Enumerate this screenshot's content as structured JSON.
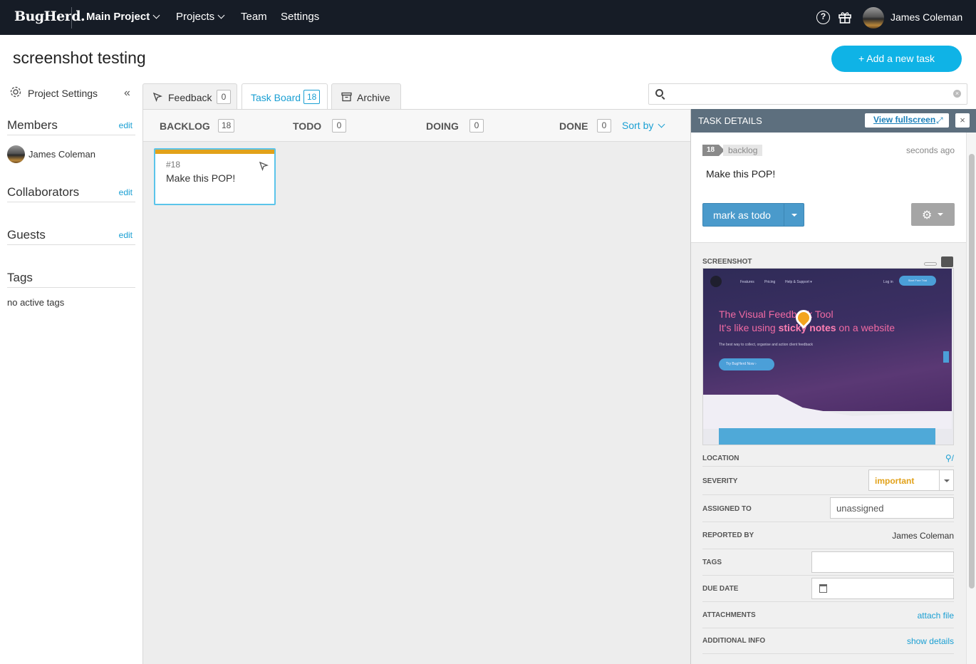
{
  "nav": {
    "logo": "BugHerd.",
    "main_project": "Main Project",
    "projects": "Projects",
    "team": "Team",
    "settings": "Settings",
    "user_name": "James Coleman",
    "help_symbol": "?"
  },
  "header": {
    "title": "screenshot testing",
    "add_task": "+ Add a new task"
  },
  "sidebar": {
    "project_settings": "Project Settings",
    "collapse_symbol": "«",
    "members_title": "Members",
    "members_edit": "edit",
    "members": [
      {
        "name": "James Coleman"
      }
    ],
    "collaborators_title": "Collaborators",
    "collaborators_edit": "edit",
    "guests_title": "Guests",
    "guests_edit": "edit",
    "tags_title": "Tags",
    "tags_empty": "no active tags"
  },
  "tabs": [
    {
      "label": "Feedback",
      "count": "0"
    },
    {
      "label": "Task Board",
      "count": "18"
    },
    {
      "label": "Archive"
    }
  ],
  "search": {
    "placeholder": "",
    "value": "",
    "clear_symbol": "×"
  },
  "board": {
    "columns": [
      {
        "title": "BACKLOG",
        "count": "18"
      },
      {
        "title": "TODO",
        "count": "0"
      },
      {
        "title": "DOING",
        "count": "0"
      },
      {
        "title": "DONE",
        "count": "0"
      }
    ],
    "sort_by": "Sort by",
    "cards": [
      {
        "number": "#18",
        "title": "Make this POP!",
        "stripe_color": "#e2a21a"
      }
    ]
  },
  "task_details": {
    "heading": "TASK DETAILS",
    "view_fullscreen": "View fullscreen",
    "fullscreen_symbol": "⤢",
    "close_symbol": "×",
    "id": "18",
    "status": "backlog",
    "time_ago": "seconds ago",
    "title": "Make this POP!",
    "primary_action": "mark as todo",
    "gear_symbol": "⚙",
    "screenshot_label": "SCREENSHOT",
    "screenshot": {
      "nav_items": [
        "Features",
        "Pricing",
        "Help & Support ▾"
      ],
      "login": "Log in",
      "trial": "Start Free Trial",
      "headline_1": "The Visual Feedback Tool",
      "headline_2_prefix": "It's like using ",
      "headline_2_bold": "sticky notes",
      "headline_2_suffix": " on a website",
      "subtext": "The best way to collect, organise and action client feedback",
      "cta": "Try BugHerd Now ›"
    },
    "fields": {
      "location_label": "LOCATION",
      "location_value": "⚲/",
      "severity_label": "SEVERITY",
      "severity_value": "important",
      "assigned_label": "ASSIGNED TO",
      "assigned_value": "unassigned",
      "reported_label": "REPORTED BY",
      "reported_value": "James Coleman",
      "tags_label": "TAGS",
      "due_label": "DUE DATE",
      "attachments_label": "ATTACHMENTS",
      "attachments_action": "attach file",
      "additional_label": "ADDITIONAL INFO",
      "additional_action": "show details"
    }
  },
  "colors": {
    "nav_bg": "#161c26",
    "accent": "#0fb3e6",
    "link": "#1a9fd3",
    "primary_button": "#4a9acb",
    "severity_important": "#e2a21a",
    "panel_header": "#5d6f7e"
  }
}
